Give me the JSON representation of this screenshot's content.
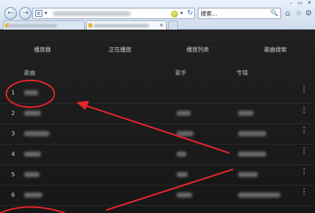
{
  "browser": {
    "nav": {
      "back_symbol": "←",
      "forward_symbol": "→"
    },
    "address": {
      "site_icon_label": "e",
      "dropdown_symbol": "▾",
      "refresh_symbol": "↻"
    },
    "search": {
      "placeholder": "搜索...",
      "icon_symbol": "🔍"
    },
    "toolbar": {
      "home_symbol": "⌂",
      "favorites_symbol": "☆",
      "tools_symbol": "⚙"
    },
    "window_controls": [
      "–",
      "▭",
      "✕"
    ],
    "tabs": [
      {
        "close_symbol": ""
      },
      {
        "close_symbol": "×"
      }
    ]
  },
  "player": {
    "top_nav": [
      "播放器",
      "正在播放",
      "播放列表",
      "歌曲搜索"
    ],
    "columns": {
      "song": "歌曲",
      "artist": "歌手",
      "album": "专辑"
    },
    "rows": [
      {
        "num": "1"
      },
      {
        "num": "2"
      },
      {
        "num": "3"
      },
      {
        "num": "4"
      },
      {
        "num": "5"
      },
      {
        "num": "6"
      }
    ],
    "more_symbol": "⋮"
  },
  "annotation_color": "#e8262b",
  "accent_colors": {
    "page_bg": "#1c1c1c",
    "chrome_bg": "#cfdcec"
  }
}
